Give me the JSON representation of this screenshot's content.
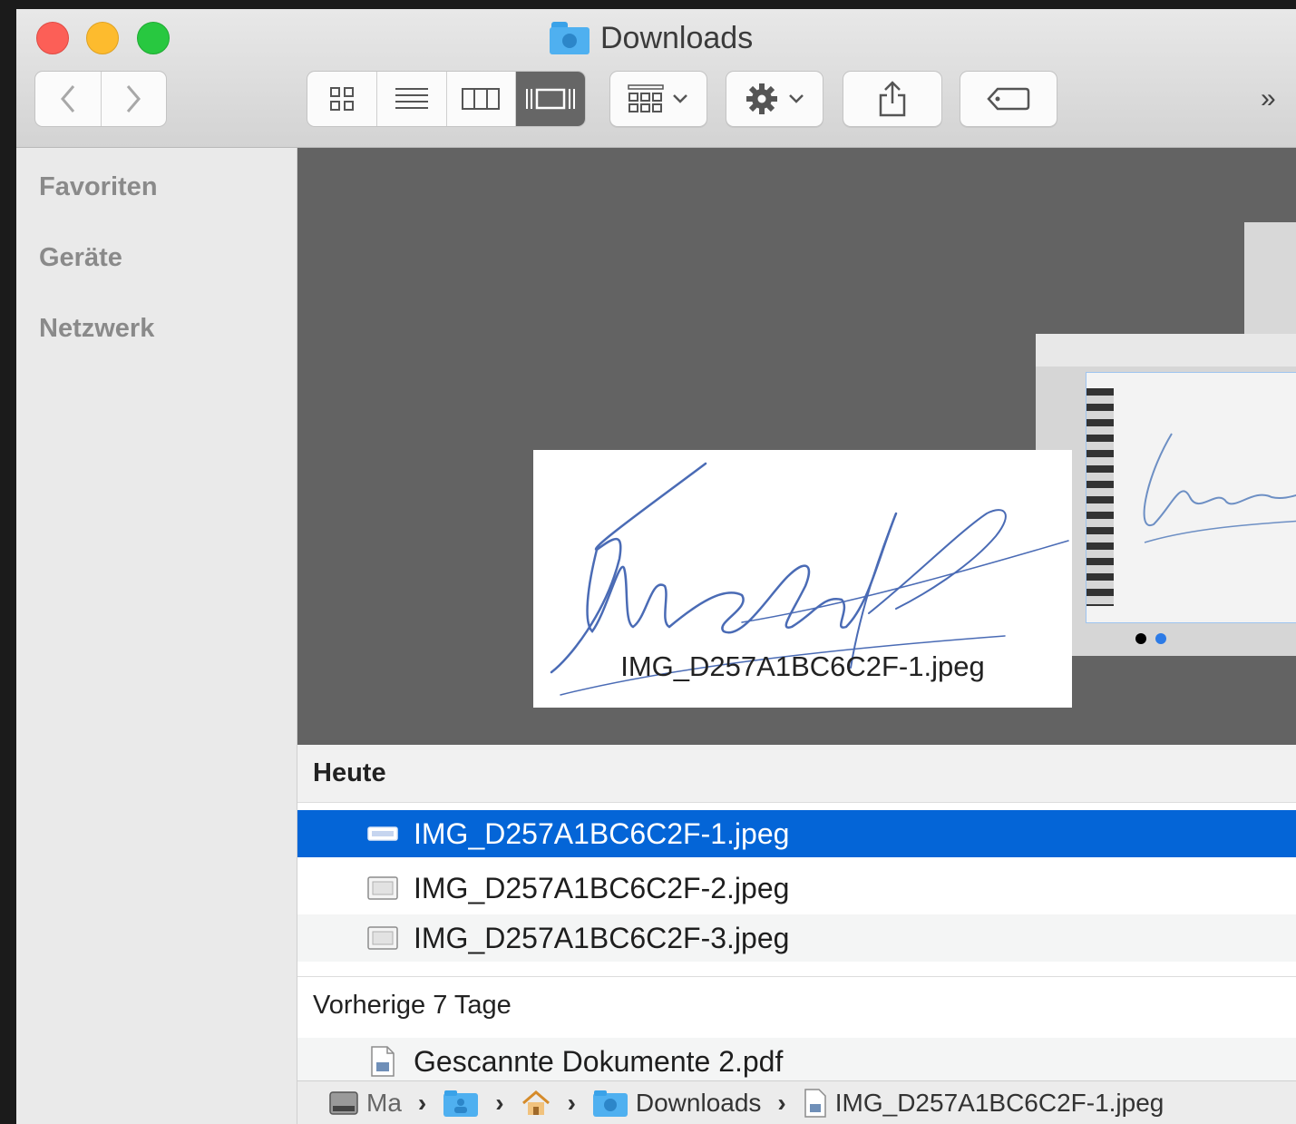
{
  "window": {
    "title": "Downloads"
  },
  "toolbar": {
    "back": "back",
    "forward": "forward",
    "views": [
      "icon-view",
      "list-view",
      "column-view",
      "coverflow-view"
    ],
    "active_view": "coverflow-view",
    "more": "»"
  },
  "sidebar": {
    "items": [
      {
        "label": "Favoriten"
      },
      {
        "label": "Geräte"
      },
      {
        "label": "Netzwerk"
      }
    ]
  },
  "coverflow": {
    "selected_label": "IMG_D257A1BC6C2F-1.jpeg"
  },
  "groups": [
    {
      "title": "Heute",
      "files": [
        {
          "name": "IMG_D257A1BC6C2F-1.jpeg",
          "selected": true
        },
        {
          "name": "IMG_D257A1BC6C2F-2.jpeg",
          "selected": false
        },
        {
          "name": "IMG_D257A1BC6C2F-3.jpeg",
          "selected": false
        }
      ]
    },
    {
      "title": "Vorherige 7 Tage",
      "files": [
        {
          "name": "Gescannte Dokumente 2.pdf",
          "selected": false
        }
      ]
    }
  ],
  "pathbar": {
    "disk": "Ma",
    "downloads": "Downloads",
    "file": "IMG_D257A1BC6C2F-1.jpeg"
  },
  "colors": {
    "selection": "#0465d7",
    "folder": "#4fb0f0",
    "close": "#fc5f57",
    "minimize": "#fdbb2e",
    "zoom": "#28c840"
  }
}
